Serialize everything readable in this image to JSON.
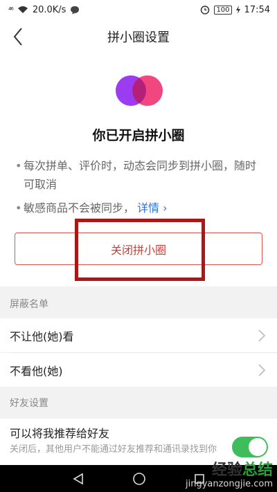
{
  "status_bar": {
    "signal": "⁴⁶",
    "speed": "20.0K/s",
    "battery": "100",
    "time": "17:54"
  },
  "nav": {
    "title": "拼小圈设置"
  },
  "hero": {
    "title": "你已开启拼小圈",
    "bullet1": "每次拼单、评价时，动态会同步到拼小圈，随时可取消",
    "bullet2": "敏感商品不会被同步，",
    "detail_link": "详情",
    "close_button": "关闭拼小圈"
  },
  "block_list": {
    "header": "屏蔽名单",
    "item1": "不让他(她)看",
    "item2": "不看他(她)"
  },
  "friends": {
    "header": "好友设置",
    "recommend_title": "可以将我推荐给好友",
    "recommend_desc": "关闭后，其他用户不能通过好友推荐和通讯录找到你",
    "recommend_enabled": true
  },
  "watermark": {
    "cn_left": "经验",
    "cn_right": "总结",
    "url": "jingyanzongjie.com"
  },
  "colors": {
    "accent_red": "#d03b35",
    "toggle_green": "#3dbd5b",
    "link_blue": "#2a73d9"
  }
}
